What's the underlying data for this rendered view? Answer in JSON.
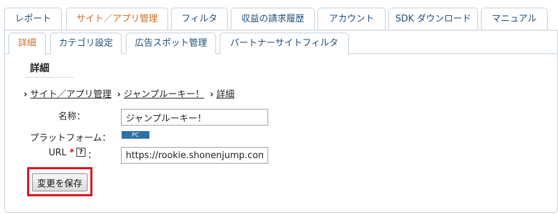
{
  "main_tabs": [
    {
      "label": "レポート"
    },
    {
      "label": "サイト／アプリ管理"
    },
    {
      "label": "フィルタ"
    },
    {
      "label": "収益の請求履歴"
    },
    {
      "label": "アカウント"
    },
    {
      "label": "SDK ダウンロード"
    },
    {
      "label": "マニュアル"
    }
  ],
  "active_main_tab": "サイト／アプリ管理",
  "sub_tabs": [
    {
      "label": "詳細"
    },
    {
      "label": "カテゴリ設定"
    },
    {
      "label": "広告スポット管理"
    },
    {
      "label": "パートナーサイトフィルタ"
    }
  ],
  "active_sub_tab": "詳細",
  "section": {
    "title": "詳細"
  },
  "breadcrumb": {
    "items": [
      "サイト／アプリ管理",
      "ジャンプルーキー！",
      "詳細"
    ]
  },
  "form": {
    "name_label": "名称：",
    "name_value": "ジャンプルーキー！",
    "platform_label": "プラットフォーム：",
    "platform_value": "PC",
    "url_label": "URL",
    "url_required_mark": "*",
    "url_help_mark": "?",
    "url_colon": "：",
    "url_value": "https://rookie.shonenjump.com"
  },
  "actions": {
    "save_label": "変更を保存"
  },
  "colors": {
    "tab_text": "#1f4e79",
    "active_tab_text": "#d2691e",
    "highlight_border": "#e01020",
    "platform_badge": "#2e6fa6"
  }
}
